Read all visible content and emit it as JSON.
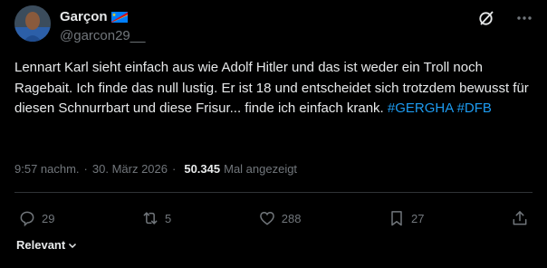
{
  "author": {
    "name": "Garçon",
    "handle": "@garcon29__"
  },
  "post": {
    "text_plain": "Lennart Karl sieht einfach aus wie Adolf Hitler und das ist weder ein Troll noch Ragebait. Ich finde das null lustig. Er ist 18 und entscheidet sich trotzdem bewusst für diesen Schnurrbart und diese Frisur... finde ich einfach krank. ",
    "hashtags": [
      "#GERGHA",
      "#DFB"
    ]
  },
  "meta": {
    "time": "9:57 nachm.",
    "separator": "·",
    "date": "30. März 2026",
    "views": "50.345",
    "views_label": "Mal angezeigt"
  },
  "actions": {
    "replies": "29",
    "reposts": "5",
    "likes": "288",
    "bookmarks": "27"
  },
  "filter": {
    "label": "Relevant"
  },
  "icons": {
    "top": [
      "grok-icon",
      "more-icon"
    ],
    "actions": [
      "reply-icon",
      "repost-icon",
      "like-icon",
      "bookmark-icon",
      "share-icon"
    ]
  },
  "colors": {
    "background": "#000000",
    "text": "#e7e9ea",
    "muted": "#71767b",
    "link": "#1d9bf0",
    "divider": "#2f3336"
  }
}
